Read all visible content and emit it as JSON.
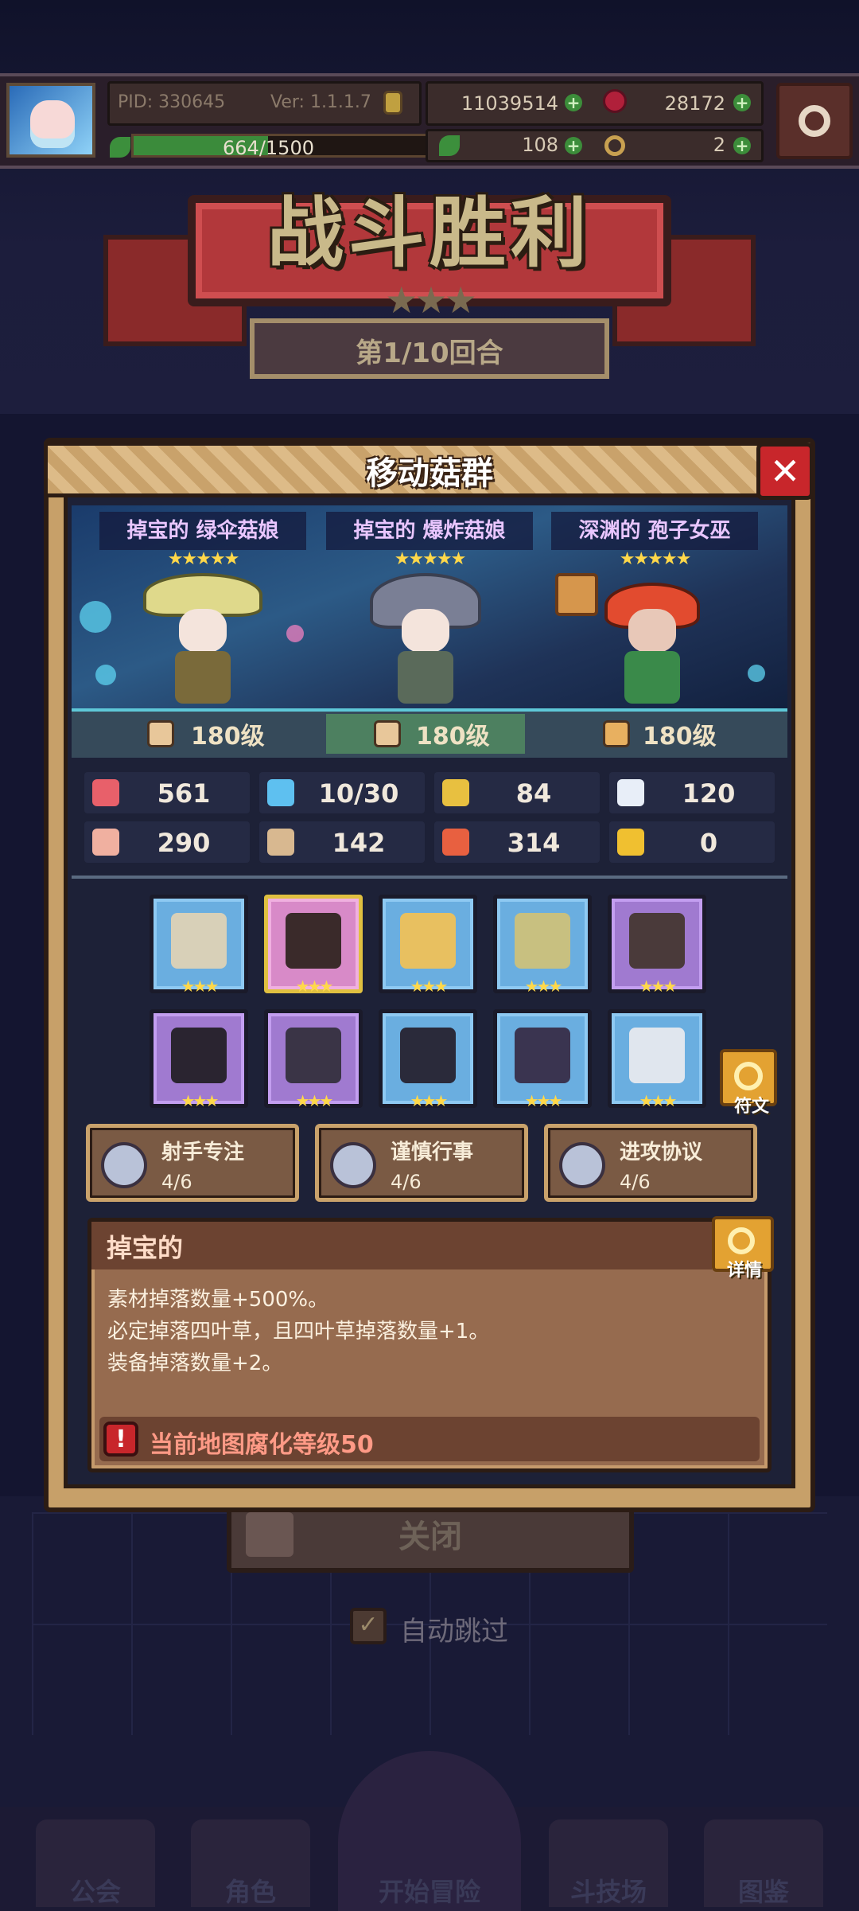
{
  "hud": {
    "pid": "PID: 330645",
    "ver": "Ver: 1.1.1.7",
    "gold": "11039514",
    "gems": "28172",
    "xp": "664/1500",
    "clover": "108",
    "keys": "2",
    "avatar_icon": "avatar-portrait",
    "settings_icon": "gear-icon"
  },
  "battle": {
    "title": "战斗胜利",
    "stars": "★★★",
    "round": "第1/10回合"
  },
  "modal": {
    "title": "移动菇群",
    "close_icon": "close-icon",
    "characters": [
      {
        "name": "掉宝的 绿伞菇娘",
        "stars": "★★★★★"
      },
      {
        "name": "掉宝的 爆炸菇娘",
        "stars": "★★★★★"
      },
      {
        "name": "深渊的 孢子女巫",
        "stars": "★★★★★"
      }
    ],
    "levels": [
      "180级",
      "180级",
      "180级"
    ],
    "stats": [
      {
        "icon": "heart-icon",
        "value": "561",
        "color": "#e8606a"
      },
      {
        "icon": "drop-icon",
        "value": "10/30",
        "color": "#5ec0f0"
      },
      {
        "icon": "shield-icon",
        "value": "84",
        "color": "#e8c040"
      },
      {
        "icon": "wing-icon",
        "value": "120",
        "color": "#e8eef8"
      },
      {
        "icon": "fist-icon",
        "value": "290",
        "color": "#f0b0a0"
      },
      {
        "icon": "book-icon",
        "value": "142",
        "color": "#d8b890"
      },
      {
        "icon": "armor-icon",
        "value": "314",
        "color": "#e86040"
      },
      {
        "icon": "magnet-icon",
        "value": "0",
        "color": "#f0c030"
      }
    ],
    "equipment_stars": "★★★",
    "rune_label": "符文",
    "skills": [
      {
        "name": "射手专注",
        "count": "4/6"
      },
      {
        "name": "谨慎行事",
        "count": "4/6"
      },
      {
        "name": "进攻协议",
        "count": "4/6"
      }
    ],
    "affix": {
      "title": "掉宝的",
      "detail_label": "详情",
      "lines": [
        "素材掉落数量+500%。",
        "必定掉落四叶草，且四叶草掉落数量+1。",
        "装备掉落数量+2。"
      ],
      "warning": "当前地图腐化等级50",
      "warning_icon": "!"
    }
  },
  "behind": {
    "close_label": "关闭",
    "auto_skip": "自动跳过",
    "checkmark": "✓"
  },
  "nav": {
    "items": [
      "公会",
      "角色",
      "开始冒险",
      "斗技场",
      "图鉴"
    ]
  }
}
